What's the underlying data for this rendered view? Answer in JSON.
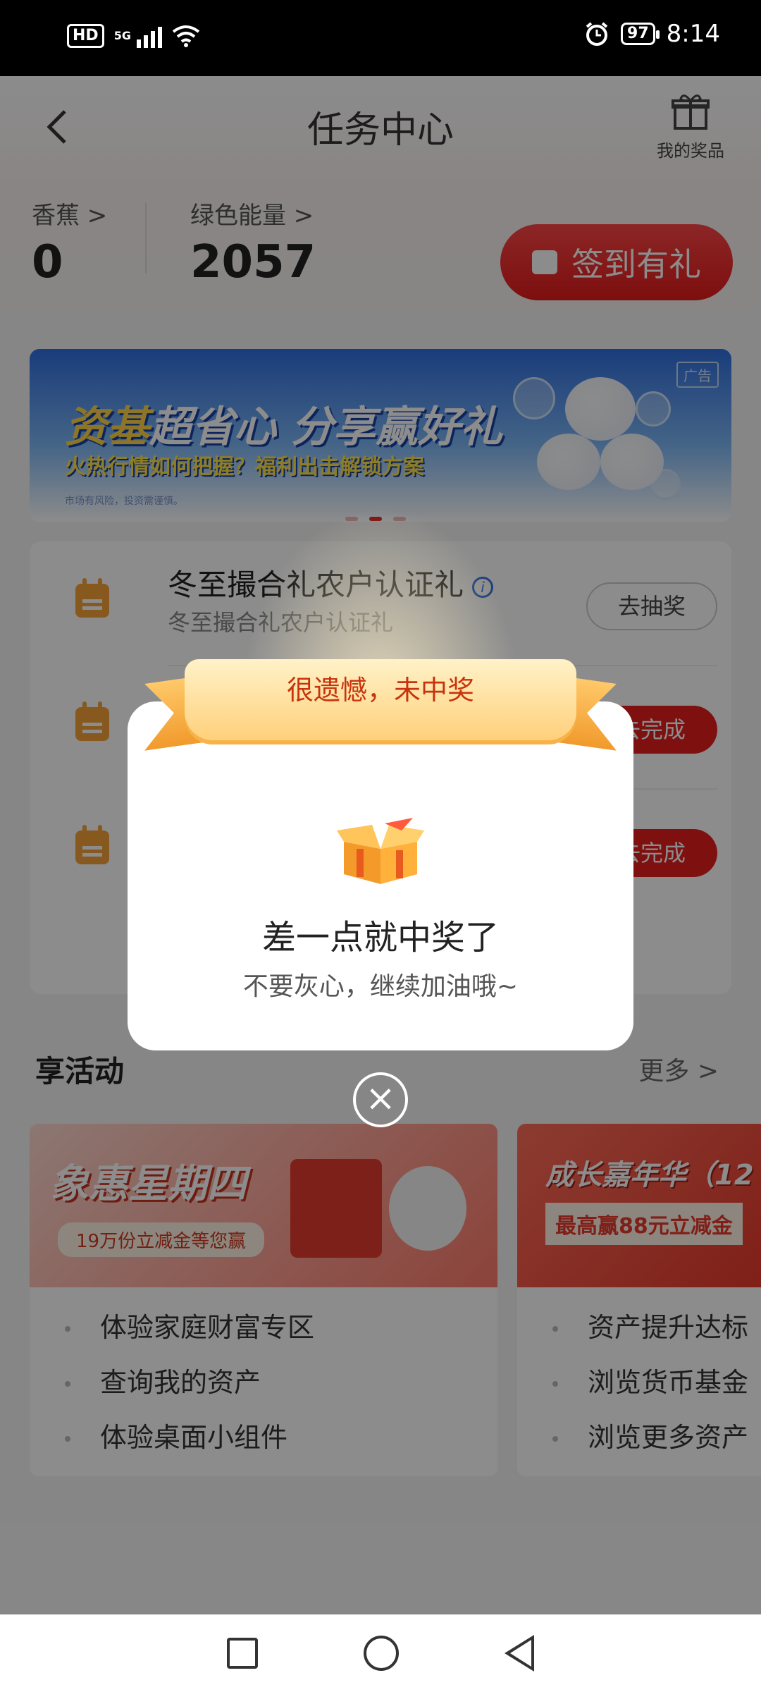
{
  "status_bar": {
    "hd": "HD",
    "network": "5G",
    "battery": "97",
    "time": "8:14"
  },
  "header": {
    "back_icon": "chevron-left-icon",
    "title": "任务中心",
    "prizes_label": "我的奖品"
  },
  "stats": {
    "banana_label": "香蕉 >",
    "banana_value": "0",
    "energy_label": "绿色能量 >",
    "energy_value": "2057",
    "checkin_label": "签到有礼"
  },
  "banner": {
    "ad_tag": "广告",
    "headline_a": "资基",
    "headline_b": "超省心 分享赢好礼",
    "subline": "火热行情如何把握？福利出击解锁方案",
    "disclaimer": "市场有风险，投资需谨慎。",
    "active_slide": 2,
    "slide_count": 3
  },
  "tasks": [
    {
      "title": "冬至撮合礼农户认证礼",
      "subtitle": "冬至撮合礼农户认证礼",
      "button": "去抽奖",
      "style": "outline"
    },
    {
      "title": "",
      "subtitle": "",
      "button": "去完成",
      "style": "red"
    },
    {
      "title": "",
      "subtitle": "",
      "button": "去完成",
      "style": "red"
    }
  ],
  "activities": {
    "title": "享活动",
    "more": "更多 >",
    "cards": [
      {
        "banner_title": "象惠星期四",
        "banner_sub": "19万份立减金等您赢",
        "items": [
          "体验家庭财富专区",
          "查询我的资产",
          "体验桌面小组件"
        ]
      },
      {
        "banner_title": "成长嘉年华（12",
        "banner_sub": "最高赢88元立减金",
        "items": [
          "资产提升达标",
          "浏览货币基金",
          "浏览更多资产"
        ]
      }
    ]
  },
  "dialog": {
    "ribbon_text": "很遗憾，未中奖",
    "title": "差一点就中奖了",
    "subtitle": "不要灰心，继续加油哦~",
    "close_icon": "close-icon"
  },
  "colors": {
    "brand_red": "#e81e1e",
    "task_icon": "#f6a23a",
    "ribbon": "#ffd07a"
  }
}
